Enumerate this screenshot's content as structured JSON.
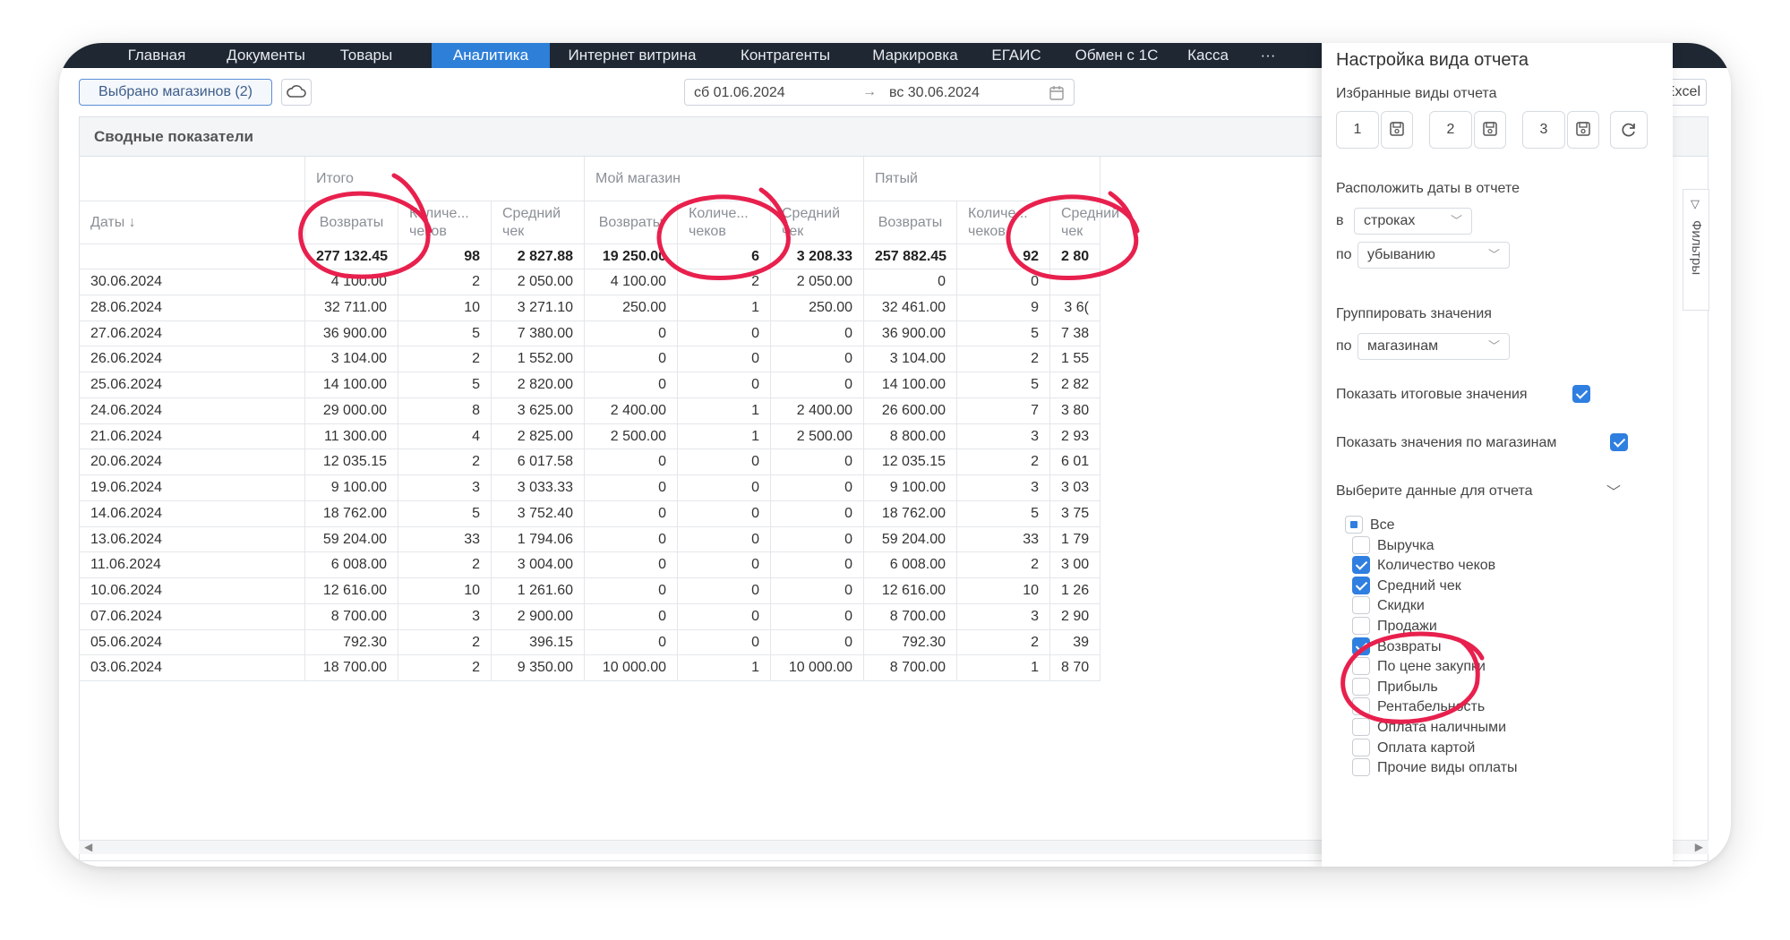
{
  "nav": {
    "items": [
      "Главная",
      "Документы",
      "Товары",
      "Аналитика",
      "Интернет витрина",
      "Контрагенты",
      "Маркировка",
      "ЕГАИС",
      "Обмен с 1С",
      "Касса",
      "···"
    ],
    "active": "Аналитика"
  },
  "toolbar": {
    "stores_label": "Выбрано магазинов (2)",
    "date_from": "сб 01.06.2024",
    "date_arrow": "→",
    "date_to": "вс 30.06.2024",
    "excel_label": "Excel"
  },
  "report": {
    "title": "Сводные показатели",
    "groups": [
      "Итого",
      "Мой магазин",
      "Пятый"
    ],
    "columns": {
      "dates": "Даты ↓",
      "returns": "Возвраты",
      "count": "Количе... чеков",
      "avg": "Средний чек"
    },
    "totals": [
      "",
      "277 132.45",
      "98",
      "2 827.88",
      "19 250.00",
      "6",
      "3 208.33",
      "257 882.45",
      "92",
      "2 80"
    ],
    "rows": [
      [
        "30.06.2024",
        "4 100.00",
        "2",
        "2 050.00",
        "4 100.00",
        "2",
        "2 050.00",
        "0",
        "0",
        ""
      ],
      [
        "28.06.2024",
        "32 711.00",
        "10",
        "3 271.10",
        "250.00",
        "1",
        "250.00",
        "32 461.00",
        "9",
        "3 6("
      ],
      [
        "27.06.2024",
        "36 900.00",
        "5",
        "7 380.00",
        "0",
        "0",
        "0",
        "36 900.00",
        "5",
        "7 38"
      ],
      [
        "26.06.2024",
        "3 104.00",
        "2",
        "1 552.00",
        "0",
        "0",
        "0",
        "3 104.00",
        "2",
        "1 55"
      ],
      [
        "25.06.2024",
        "14 100.00",
        "5",
        "2 820.00",
        "0",
        "0",
        "0",
        "14 100.00",
        "5",
        "2 82"
      ],
      [
        "24.06.2024",
        "29 000.00",
        "8",
        "3 625.00",
        "2 400.00",
        "1",
        "2 400.00",
        "26 600.00",
        "7",
        "3 80"
      ],
      [
        "21.06.2024",
        "11 300.00",
        "4",
        "2 825.00",
        "2 500.00",
        "1",
        "2 500.00",
        "8 800.00",
        "3",
        "2 93"
      ],
      [
        "20.06.2024",
        "12 035.15",
        "2",
        "6 017.58",
        "0",
        "0",
        "0",
        "12 035.15",
        "2",
        "6 01"
      ],
      [
        "19.06.2024",
        "9 100.00",
        "3",
        "3 033.33",
        "0",
        "0",
        "0",
        "9 100.00",
        "3",
        "3 03"
      ],
      [
        "14.06.2024",
        "18 762.00",
        "5",
        "3 752.40",
        "0",
        "0",
        "0",
        "18 762.00",
        "5",
        "3 75"
      ],
      [
        "13.06.2024",
        "59 204.00",
        "33",
        "1 794.06",
        "0",
        "0",
        "0",
        "59 204.00",
        "33",
        "1 79"
      ],
      [
        "11.06.2024",
        "6 008.00",
        "2",
        "3 004.00",
        "0",
        "0",
        "0",
        "6 008.00",
        "2",
        "3 00"
      ],
      [
        "10.06.2024",
        "12 616.00",
        "10",
        "1 261.60",
        "0",
        "0",
        "0",
        "12 616.00",
        "10",
        "1 26"
      ],
      [
        "07.06.2024",
        "8 700.00",
        "3",
        "2 900.00",
        "0",
        "0",
        "0",
        "8 700.00",
        "3",
        "2 90"
      ],
      [
        "05.06.2024",
        "792.30",
        "2",
        "396.15",
        "0",
        "0",
        "0",
        "792.30",
        "2",
        "39"
      ],
      [
        "03.06.2024",
        "18 700.00",
        "2",
        "9 350.00",
        "10 000.00",
        "1",
        "10 000.00",
        "8 700.00",
        "1",
        "8 70"
      ]
    ],
    "filters_label": "Фильтры"
  },
  "panel": {
    "title": "Настройка вида отчета",
    "favorites_label": "Избранные виды отчета",
    "favorites": [
      "1",
      "2",
      "3"
    ],
    "arrange_label": "Расположить даты в отчете",
    "in_prefix": "в",
    "in_value": "строках",
    "order_prefix": "по",
    "order_value": "убыванию",
    "group_label": "Группировать значения",
    "group_prefix": "по",
    "group_value": "магазинам",
    "show_totals_label": "Показать итоговые значения",
    "show_totals": true,
    "show_by_store_label": "Показать значения по магазинам",
    "show_by_store": true,
    "data_select_label": "Выберите данные для отчета",
    "options": [
      {
        "label": "Все",
        "state": "partial"
      },
      {
        "label": "Выручка",
        "state": "off"
      },
      {
        "label": "Количество чеков",
        "state": "on"
      },
      {
        "label": "Средний чек",
        "state": "on"
      },
      {
        "label": "Скидки",
        "state": "off"
      },
      {
        "label": "Продажи",
        "state": "off"
      },
      {
        "label": "Возвраты",
        "state": "on"
      },
      {
        "label": "По цене закупки",
        "state": "off"
      },
      {
        "label": "Прибыль",
        "state": "off"
      },
      {
        "label": "Рентабельность",
        "state": "off"
      },
      {
        "label": "Оплата наличными",
        "state": "off"
      },
      {
        "label": "Оплата картой",
        "state": "off"
      },
      {
        "label": "Прочие виды оплаты",
        "state": "off"
      }
    ]
  },
  "colors": {
    "nav_bg": "#1f2733",
    "nav_active": "#2e7fd8",
    "checkbox": "#2f7fe0",
    "annotation_red": "#e8204d"
  }
}
